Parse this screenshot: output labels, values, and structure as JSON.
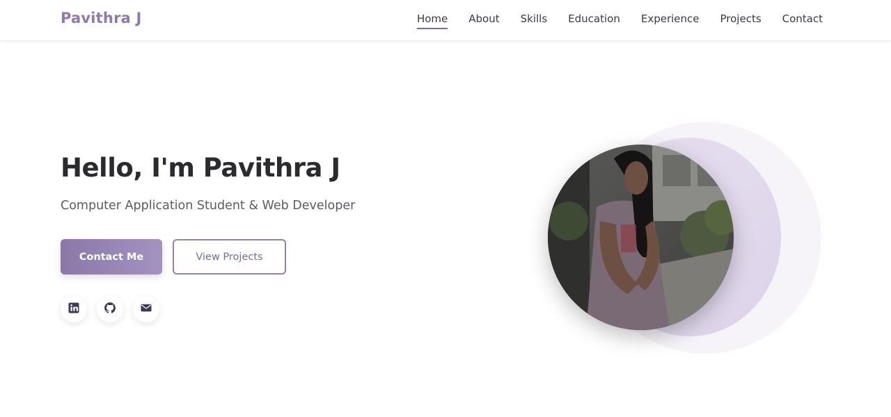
{
  "brand": {
    "name": "Pavithra J",
    "color": "#8e7bab"
  },
  "nav": {
    "items": [
      {
        "label": "Home",
        "active": true
      },
      {
        "label": "About"
      },
      {
        "label": "Skills"
      },
      {
        "label": "Education"
      },
      {
        "label": "Experience"
      },
      {
        "label": "Projects"
      },
      {
        "label": "Contact"
      }
    ]
  },
  "hero": {
    "title": "Hello, I'm Pavithra J",
    "subtitle": "Computer Application Student & Web Developer",
    "primary_button": "Contact Me",
    "secondary_button": "View Projects",
    "social": [
      {
        "icon": "linkedin-icon"
      },
      {
        "icon": "github-icon"
      },
      {
        "icon": "envelope-icon"
      }
    ],
    "accent_color": "#8a78a8"
  }
}
